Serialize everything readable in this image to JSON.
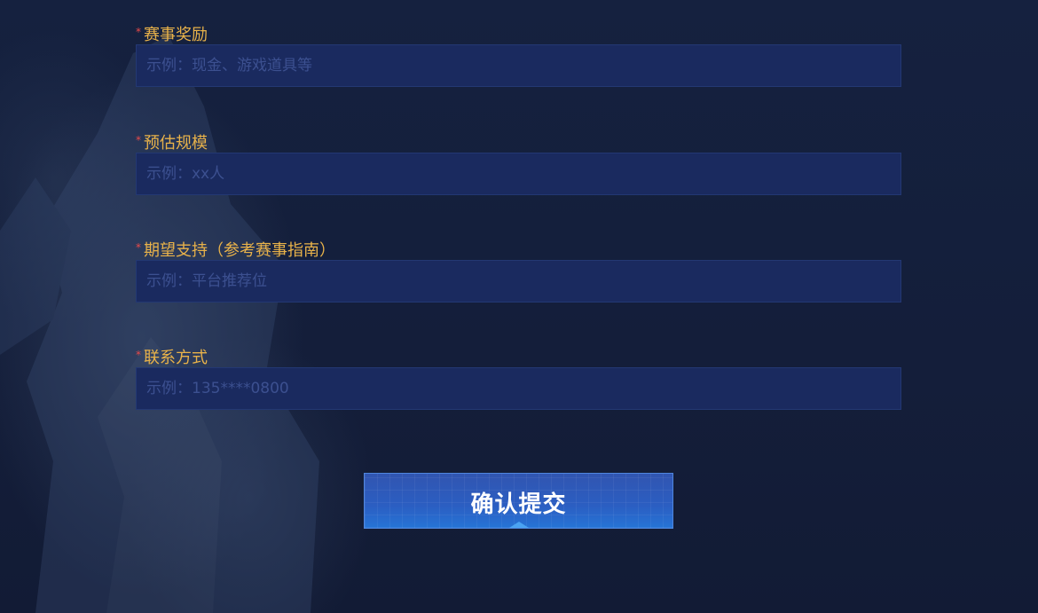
{
  "form": {
    "fields": [
      {
        "label": "赛事奖励",
        "placeholder": "示例：现金、游戏道具等",
        "required_mark": "*"
      },
      {
        "label": "预估规模",
        "placeholder": "示例：xx人",
        "required_mark": "*"
      },
      {
        "label": "期望支持（参考赛事指南）",
        "placeholder": "示例：平台推荐位",
        "required_mark": "*"
      },
      {
        "label": "联系方式",
        "placeholder": "示例：135****0800",
        "required_mark": "*"
      }
    ],
    "submit_label": "确认提交"
  },
  "colors": {
    "background": "#141f3c",
    "label": "#e8b24a",
    "required": "#e84a4a",
    "input_bg": "#1a2a5f",
    "input_border": "#233873",
    "placeholder": "#3c5090",
    "button": "#2b5ec2"
  }
}
